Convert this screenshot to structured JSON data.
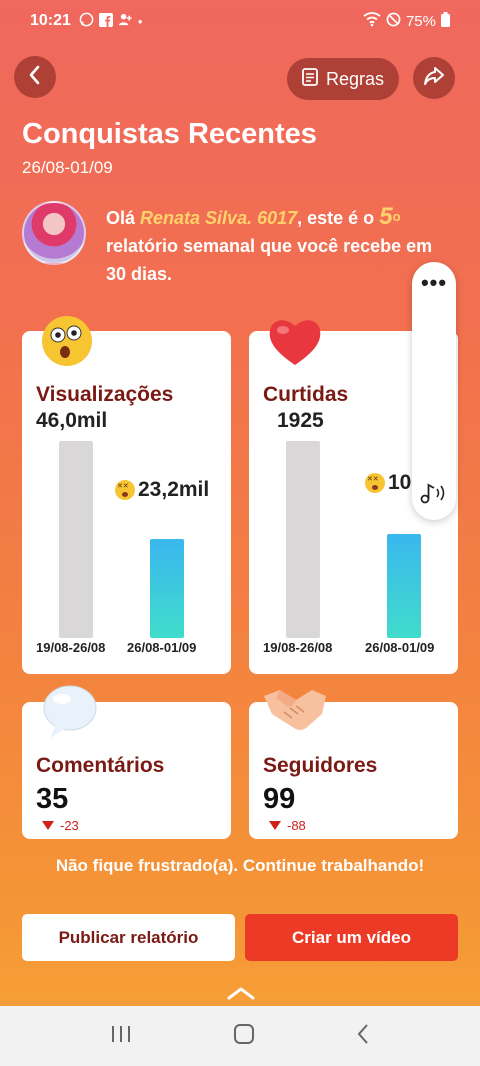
{
  "status_bar": {
    "time": "10:21",
    "battery": "75%",
    "dot": "•"
  },
  "header": {
    "back_icon": "chevron-left-icon",
    "rules_label": "Regras",
    "share_icon": "share-icon"
  },
  "page": {
    "title": "Conquistas Recentes",
    "date_range": "26/08-01/09"
  },
  "greeting": {
    "prefix": "Olá",
    "name": "Renata Silva. 6017",
    "middle": ", este é o",
    "number": "5",
    "ordinal": "o",
    "suffix": "relatório semanal que você recebe em 30 dias."
  },
  "cards": {
    "views": {
      "label": "Visualizações",
      "previous_value": "46,0mil",
      "current_value": "23,2mil",
      "previous_period": "19/08-26/08",
      "current_period": "26/08-01/09",
      "previous_ratio": 1.0,
      "current_ratio": 0.5
    },
    "likes": {
      "label": "Curtidas",
      "previous_value": "1925",
      "current_value": "10",
      "previous_period": "19/08-26/08",
      "current_period": "26/08-01/09",
      "previous_ratio": 1.0,
      "current_ratio": 0.53
    },
    "comments": {
      "label": "Comentários",
      "value": "35",
      "delta": "-23"
    },
    "followers": {
      "label": "Seguidores",
      "value": "99",
      "delta": "-88"
    }
  },
  "motivation": "Não fique frustrado(a). Continue trabalhando!",
  "buttons": {
    "publish": "Publicar relatório",
    "create": "Criar um vídeo"
  },
  "floating_panel": {
    "menu": "•••"
  },
  "colors": {
    "accent_red": "#ec3a26",
    "label_dark_red": "#7a1a14",
    "highlight_yellow": "#ffd36a",
    "bar_cyan": "#3ab7ee",
    "delta_red": "#d0201a"
  }
}
